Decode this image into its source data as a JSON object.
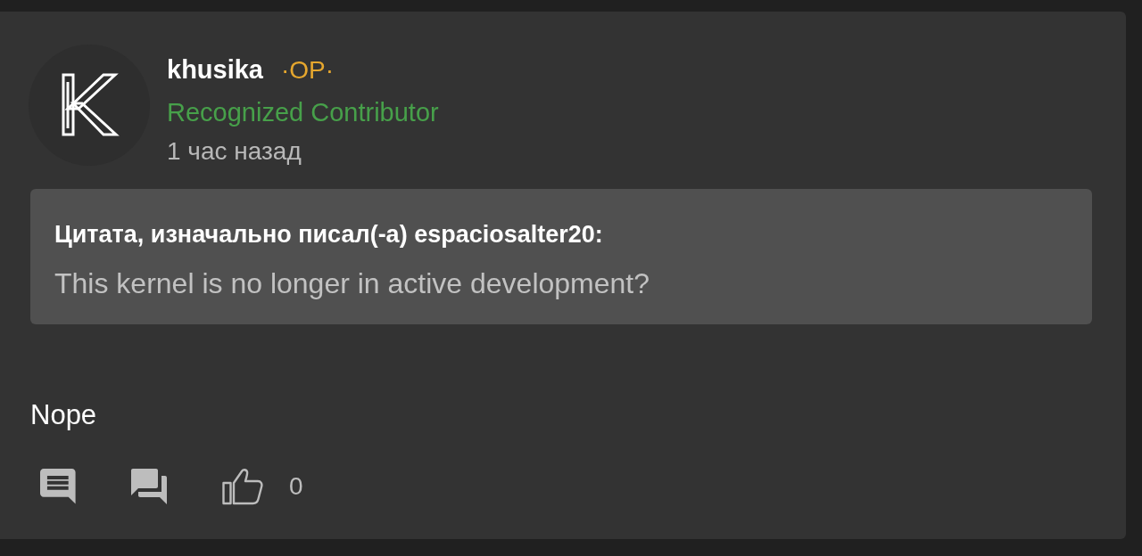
{
  "post": {
    "author": {
      "name": "khusika",
      "badge": "·OP·",
      "rank": "Recognized Contributor",
      "time": "1 час назад"
    },
    "quote": {
      "header": "Цитата, изначально писал(-а) espaciosalter20:",
      "text": "This kernel is no longer in active development?"
    },
    "body": "Nope",
    "actions": [
      {
        "kind": "comment"
      },
      {
        "kind": "reply"
      },
      {
        "kind": "like",
        "count": "0"
      }
    ]
  }
}
